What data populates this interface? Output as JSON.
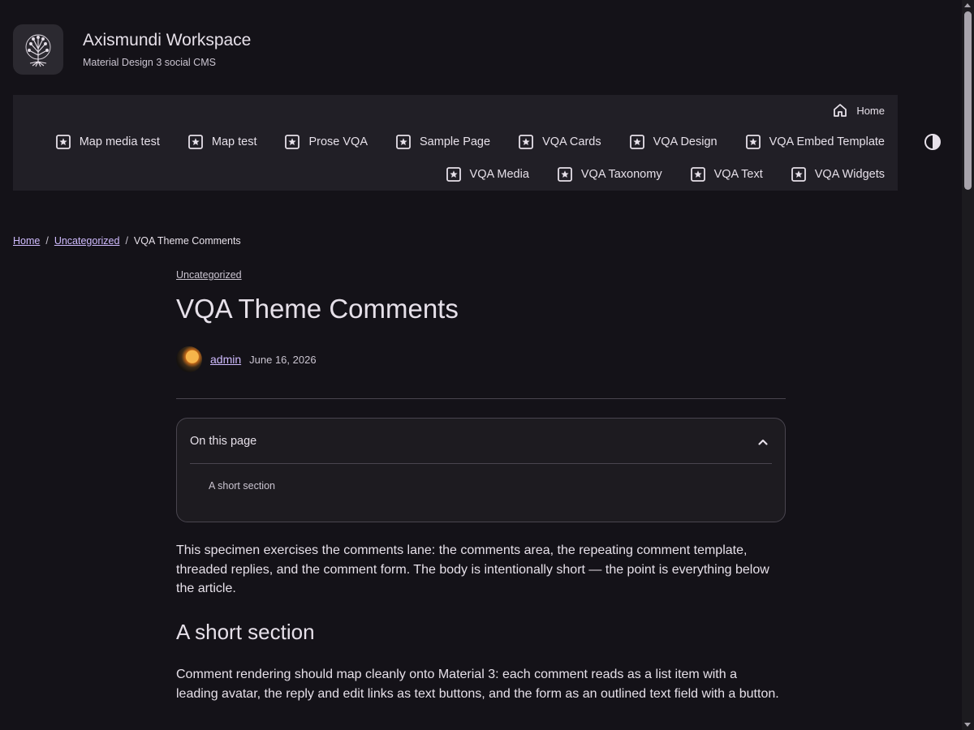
{
  "site": {
    "title": "Axismundi Workspace",
    "tagline": "Material Design 3 social CMS"
  },
  "nav": {
    "row1": [
      {
        "label": "Home",
        "icon": "home-icon"
      }
    ],
    "row2": [
      {
        "label": "Map media test",
        "icon": "star-box-icon"
      },
      {
        "label": "Map test",
        "icon": "star-box-icon"
      },
      {
        "label": "Prose VQA",
        "icon": "star-box-icon"
      },
      {
        "label": "Sample Page",
        "icon": "star-box-icon"
      },
      {
        "label": "VQA Cards",
        "icon": "star-box-icon"
      },
      {
        "label": "VQA Design",
        "icon": "star-box-icon"
      },
      {
        "label": "VQA Embed Template",
        "icon": "star-box-icon"
      }
    ],
    "row3": [
      {
        "label": "VQA Media",
        "icon": "star-box-icon"
      },
      {
        "label": "VQA Taxonomy",
        "icon": "star-box-icon"
      },
      {
        "label": "VQA Text",
        "icon": "star-box-icon"
      },
      {
        "label": "VQA Widgets",
        "icon": "star-box-icon"
      }
    ]
  },
  "breadcrumb": {
    "home": "Home",
    "category": "Uncategorized",
    "current": "VQA Theme Comments",
    "separator": "/"
  },
  "article": {
    "category": "Uncategorized",
    "title": "VQA Theme Comments",
    "author": "admin",
    "date": "June 16, 2026",
    "toc": {
      "title": "On this page",
      "items": [
        "A short section"
      ]
    },
    "intro": "This specimen exercises the comments lane: the comments area, the repeating comment template, threaded replies, and the comment form. The body is intentionally short — the point is everything below the article.",
    "section_heading": "A short section",
    "section_body": "Comment rendering should map cleanly onto Material 3: each comment reads as a list item with a leading avatar, the reply and edit links as text buttons, and the form as an outlined text field with a button."
  },
  "colors": {
    "background": "#141218",
    "surface": "#211f26",
    "primary": "#d0bcff",
    "on_surface": "#e6e0e9",
    "outline": "#49454f"
  }
}
